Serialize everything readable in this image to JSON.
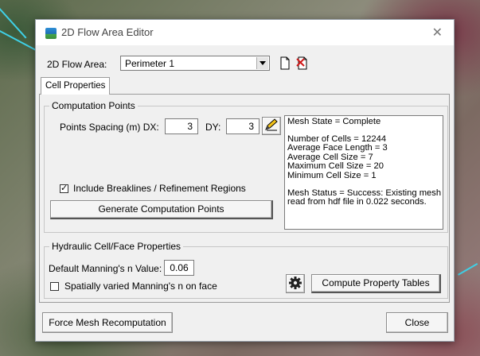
{
  "window": {
    "title": "2D Flow Area Editor",
    "close_glyph": "✕"
  },
  "flow_area": {
    "label": "2D Flow Area:",
    "selected": "Perimeter 1",
    "new_icon": "new-document-icon",
    "edit_icon": "edit-document-icon"
  },
  "tabs": [
    {
      "label": "Cell Properties",
      "active": true
    }
  ],
  "computation_points": {
    "group_title": "Computation Points",
    "spacing_label": "Points Spacing (m) DX:",
    "dx_value": "3",
    "dy_label": "DY:",
    "dy_value": "3",
    "include_breaklines_label": "Include Breaklines / Refinement Regions",
    "include_breaklines_checked": true,
    "generate_button": "Generate Computation Points"
  },
  "mesh_info": {
    "lines": [
      "Mesh State = Complete",
      "",
      "Number of Cells = 12244",
      "Average Face Length = 3",
      "Average Cell Size = 7",
      "Maximum Cell Size = 20",
      "Minimum Cell Size = 1",
      "",
      "Mesh Status = Success: Existing mesh",
      "read from hdf file in 0.022 seconds."
    ]
  },
  "hydraulic": {
    "group_title": "Hydraulic Cell/Face Properties",
    "mannings_label": "Default Manning's n Value:",
    "mannings_value": "0.06",
    "spatial_label": "Spatially varied Manning's n on face",
    "spatial_checked": false,
    "compute_button": "Compute Property Tables"
  },
  "footer": {
    "force_button": "Force Mesh Recomputation",
    "close_button": "Close"
  },
  "colors": {
    "dialog_bg": "#f0f0f0",
    "perimeter_line": "#3fd0e6"
  }
}
